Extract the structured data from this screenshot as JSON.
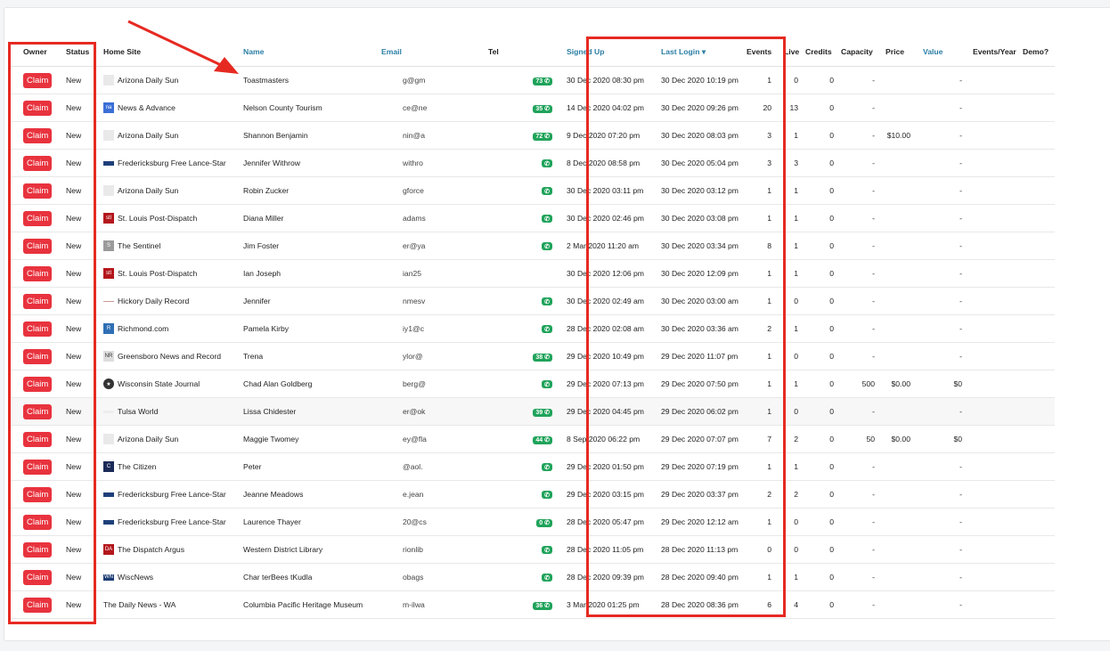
{
  "headers": {
    "owner": "Owner",
    "status": "Status",
    "home_site": "Home Site",
    "name": "Name",
    "email": "Email",
    "tel": "Tel",
    "signed_up": "Signed Up",
    "last_login": "Last Login ▾",
    "events": "Events",
    "live": "Live",
    "credits": "Credits",
    "capacity": "Capacity",
    "price": "Price",
    "value": "Value",
    "events_year": "Events/Year",
    "demo": "Demo?"
  },
  "claim_label": "Claim",
  "rows": [
    {
      "status": "New",
      "site": "Arizona Daily Sun",
      "logo": "azds",
      "name": "Toastmasters",
      "email": "g@gm",
      "tel": "73",
      "signed_up": "30 Dec 2020 08:30 pm",
      "last_login": "30 Dec 2020 10:19 pm",
      "events": "1",
      "live": "0",
      "credits": "0",
      "capacity": "-",
      "price": "",
      "value": "-"
    },
    {
      "status": "New",
      "site": "News & Advance",
      "logo": "na",
      "name": "Nelson County Tourism",
      "email": "ce@ne",
      "tel": "35",
      "signed_up": "14 Dec 2020 04:02 pm",
      "last_login": "30 Dec 2020 09:26 pm",
      "events": "20",
      "live": "13",
      "credits": "0",
      "capacity": "-",
      "price": "",
      "value": "-"
    },
    {
      "status": "New",
      "site": "Arizona Daily Sun",
      "logo": "azds",
      "name": "Shannon Benjamin",
      "email": "nin@a",
      "tel": "72",
      "signed_up": "9 Dec 2020 07:20 pm",
      "last_login": "30 Dec 2020 08:03 pm",
      "events": "3",
      "live": "1",
      "credits": "0",
      "capacity": "-",
      "price": "$10.00",
      "value": "-"
    },
    {
      "status": "New",
      "site": "Fredericksburg Free Lance-Star",
      "logo": "fls",
      "name": "Jennifer Withrow",
      "email": "withro",
      "tel": "",
      "signed_up": "8 Dec 2020 08:58 pm",
      "last_login": "30 Dec 2020 05:04 pm",
      "events": "3",
      "live": "3",
      "credits": "0",
      "capacity": "-",
      "price": "",
      "value": "-"
    },
    {
      "status": "New",
      "site": "Arizona Daily Sun",
      "logo": "azds",
      "name": "Robin Zucker",
      "email": "gforce",
      "tel": "",
      "signed_up": "30 Dec 2020 03:11 pm",
      "last_login": "30 Dec 2020 03:12 pm",
      "events": "1",
      "live": "1",
      "credits": "0",
      "capacity": "-",
      "price": "",
      "value": "-"
    },
    {
      "status": "New",
      "site": "St. Louis Post-Dispatch",
      "logo": "stl",
      "name": "Diana Miller",
      "email": "adams",
      "tel": "",
      "signed_up": "30 Dec 2020 02:46 pm",
      "last_login": "30 Dec 2020 03:08 pm",
      "events": "1",
      "live": "1",
      "credits": "0",
      "capacity": "-",
      "price": "",
      "value": "-"
    },
    {
      "status": "New",
      "site": "The Sentinel",
      "logo": "sent",
      "name": "Jim Foster",
      "email": "er@ya",
      "tel": "",
      "signed_up": "2 Mar 2020 11:20 am",
      "last_login": "30 Dec 2020 03:34 pm",
      "events": "8",
      "live": "1",
      "credits": "0",
      "capacity": "-",
      "price": "",
      "value": "-"
    },
    {
      "status": "New",
      "site": "St. Louis Post-Dispatch",
      "logo": "stl",
      "name": "Ian Joseph",
      "email": "ian25",
      "tel": "none",
      "signed_up": "30 Dec 2020 12:06 pm",
      "last_login": "30 Dec 2020 12:09 pm",
      "events": "1",
      "live": "1",
      "credits": "0",
      "capacity": "-",
      "price": "",
      "value": "-"
    },
    {
      "status": "New",
      "site": "Hickory Daily Record",
      "logo": "hdr",
      "name": "Jennifer",
      "email": "nmesv",
      "tel": "",
      "signed_up": "30 Dec 2020 02:49 am",
      "last_login": "30 Dec 2020 03:00 am",
      "events": "1",
      "live": "0",
      "credits": "0",
      "capacity": "-",
      "price": "",
      "value": "-"
    },
    {
      "status": "New",
      "site": "Richmond.com",
      "logo": "rich",
      "name": "Pamela Kirby",
      "email": "iy1@c",
      "tel": "",
      "signed_up": "28 Dec 2020 02:08 am",
      "last_login": "30 Dec 2020 03:36 am",
      "events": "2",
      "live": "1",
      "credits": "0",
      "capacity": "-",
      "price": "",
      "value": "-"
    },
    {
      "status": "New",
      "site": "Greensboro News and Record",
      "logo": "gnr",
      "name": "Trena",
      "email": "ylor@",
      "tel": "38",
      "signed_up": "29 Dec 2020 10:49 pm",
      "last_login": "29 Dec 2020 11:07 pm",
      "events": "1",
      "live": "0",
      "credits": "0",
      "capacity": "-",
      "price": "",
      "value": "-"
    },
    {
      "status": "New",
      "site": "Wisconsin State Journal",
      "logo": "wsj",
      "name": "Chad Alan Goldberg",
      "email": "berg@",
      "tel": "",
      "signed_up": "29 Dec 2020 07:13 pm",
      "last_login": "29 Dec 2020 07:50 pm",
      "events": "1",
      "live": "1",
      "credits": "0",
      "capacity": "500",
      "price": "$0.00",
      "value": "$0"
    },
    {
      "status": "New",
      "site": "Tulsa World",
      "logo": "tw",
      "name": "Lissa Chidester",
      "email": "er@ok",
      "tel": "39",
      "signed_up": "29 Dec 2020 04:45 pm",
      "last_login": "29 Dec 2020 06:02 pm",
      "events": "1",
      "live": "0",
      "credits": "0",
      "capacity": "-",
      "price": "",
      "value": "-",
      "hl": true
    },
    {
      "status": "New",
      "site": "Arizona Daily Sun",
      "logo": "azds",
      "name": "Maggie Twomey",
      "email": "ey@fla",
      "tel": "44",
      "signed_up": "8 Sep 2020 06:22 pm",
      "last_login": "29 Dec 2020 07:07 pm",
      "events": "7",
      "live": "2",
      "credits": "0",
      "capacity": "50",
      "price": "$0.00",
      "value": "$0"
    },
    {
      "status": "New",
      "site": "The Citizen",
      "logo": "cit",
      "name": "Peter",
      "email": "@aol.",
      "tel": "",
      "signed_up": "29 Dec 2020 01:50 pm",
      "last_login": "29 Dec 2020 07:19 pm",
      "events": "1",
      "live": "1",
      "credits": "0",
      "capacity": "-",
      "price": "",
      "value": "-"
    },
    {
      "status": "New",
      "site": "Fredericksburg Free Lance-Star",
      "logo": "fls",
      "name": "Jeanne Meadows",
      "email": "e.jean",
      "tel": "",
      "signed_up": "29 Dec 2020 03:15 pm",
      "last_login": "29 Dec 2020 03:37 pm",
      "events": "2",
      "live": "2",
      "credits": "0",
      "capacity": "-",
      "price": "",
      "value": "-"
    },
    {
      "status": "New",
      "site": "Fredericksburg Free Lance-Star",
      "logo": "fls",
      "name": "Laurence Thayer",
      "email": "20@cs",
      "tel": "0",
      "signed_up": "28 Dec 2020 05:47 pm",
      "last_login": "29 Dec 2020 12:12 am",
      "events": "1",
      "live": "0",
      "credits": "0",
      "capacity": "-",
      "price": "",
      "value": "-"
    },
    {
      "status": "New",
      "site": "The Dispatch Argus",
      "logo": "da",
      "name": "Western District Library",
      "email": "rionlib",
      "tel": "",
      "signed_up": "28 Dec 2020 11:05 pm",
      "last_login": "28 Dec 2020 11:13 pm",
      "events": "0",
      "live": "0",
      "credits": "0",
      "capacity": "-",
      "price": "",
      "value": "-"
    },
    {
      "status": "New",
      "site": "WiscNews",
      "logo": "wn",
      "name": "Char terBees tKudla",
      "email": "obags",
      "tel": "",
      "signed_up": "28 Dec 2020 09:39 pm",
      "last_login": "28 Dec 2020 09:40 pm",
      "events": "1",
      "live": "1",
      "credits": "0",
      "capacity": "-",
      "price": "",
      "value": "-"
    },
    {
      "status": "New",
      "site": "The Daily News - WA",
      "logo": "none",
      "name": "Columbia Pacific Heritage Museum",
      "email": "m-ilwa",
      "tel": "36",
      "signed_up": "3 Mar 2020 01:25 pm",
      "last_login": "28 Dec 2020 08:36 pm",
      "events": "6",
      "live": "4",
      "credits": "0",
      "capacity": "-",
      "price": "",
      "value": "-"
    }
  ]
}
